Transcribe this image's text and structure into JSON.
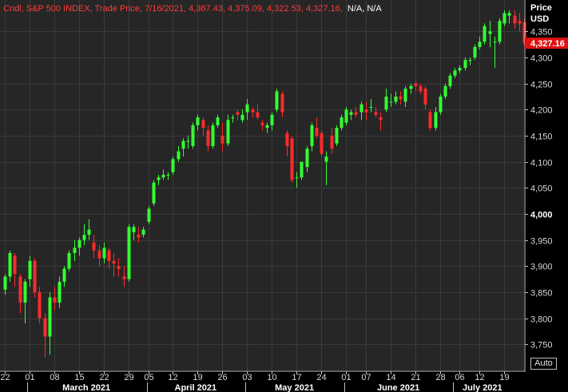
{
  "header": {
    "main": "Cndl, S&P 500 INDEX, Trade Price, 7/16/2021, 4,367.43, 4,375.09, 4,322.53, 4,327.16,",
    "extra": "N/A, N/A"
  },
  "price_axis": {
    "label_line1": "Price",
    "label_line2": "USD",
    "last_price": "4,327.16"
  },
  "auto_button": "Auto",
  "colors": {
    "background": "#000000",
    "plot_bg": "#262626",
    "grid": "#3a3a3a",
    "up": "#33ff33",
    "down": "#ff2a2a",
    "title": "#ff3b3b",
    "badge": "#e01010"
  },
  "chart_data": {
    "type": "candlestick",
    "title": "Cndl, S&P 500 INDEX, Trade Price, 7/16/2021, 4,367.43, 4,375.09, 4,322.53, 4,327.16, N/A, N/A",
    "ylim": [
      3700,
      4410
    ],
    "yticks": [
      3750,
      3800,
      3850,
      3900,
      3950,
      4000,
      4050,
      4100,
      4150,
      4200,
      4250,
      4300,
      4350
    ],
    "ytick_labels": [
      "3,750",
      "3,800",
      "3,850",
      "3,900",
      "3,950",
      "4,000",
      "4,050",
      "4,100",
      "4,150",
      "4,200",
      "4,250",
      "4,300",
      "4,350"
    ],
    "bold_tick": 4000,
    "grid": true,
    "last_price": 4327.16,
    "day_ticks": [
      {
        "label": "22",
        "index": 0
      },
      {
        "label": "01",
        "index": 5
      },
      {
        "label": "08",
        "index": 10
      },
      {
        "label": "15",
        "index": 15
      },
      {
        "label": "22",
        "index": 20
      },
      {
        "label": "29",
        "index": 25
      },
      {
        "label": "05",
        "index": 29
      },
      {
        "label": "12",
        "index": 34
      },
      {
        "label": "19",
        "index": 39
      },
      {
        "label": "26",
        "index": 44
      },
      {
        "label": "03",
        "index": 49
      },
      {
        "label": "10",
        "index": 54
      },
      {
        "label": "17",
        "index": 59
      },
      {
        "label": "24",
        "index": 64
      },
      {
        "label": "01",
        "index": 69
      },
      {
        "label": "07",
        "index": 73
      },
      {
        "label": "14",
        "index": 78
      },
      {
        "label": "21",
        "index": 83
      },
      {
        "label": "28",
        "index": 88
      },
      {
        "label": "06",
        "index": 92
      },
      {
        "label": "12",
        "index": 96
      },
      {
        "label": "19",
        "index": 101
      }
    ],
    "months": [
      {
        "label": "March 2021",
        "start": 5,
        "end": 28
      },
      {
        "label": "April 2021",
        "start": 29,
        "end": 48
      },
      {
        "label": "May 2021",
        "start": 49,
        "end": 68
      },
      {
        "label": "June 2021",
        "start": 69,
        "end": 90
      },
      {
        "label": "July 2021",
        "start": 91,
        "end": 102
      }
    ],
    "ohlc": [
      [
        3855,
        3885,
        3845,
        3880
      ],
      [
        3880,
        3930,
        3870,
        3925
      ],
      [
        3920,
        3925,
        3860,
        3885
      ],
      [
        3880,
        3885,
        3810,
        3830
      ],
      [
        3830,
        3875,
        3790,
        3870
      ],
      [
        3875,
        3920,
        3860,
        3910
      ],
      [
        3910,
        3915,
        3840,
        3850
      ],
      [
        3850,
        3860,
        3790,
        3800
      ],
      [
        3800,
        3810,
        3725,
        3765
      ],
      [
        3765,
        3850,
        3730,
        3840
      ],
      [
        3840,
        3860,
        3815,
        3830
      ],
      [
        3830,
        3880,
        3820,
        3870
      ],
      [
        3870,
        3900,
        3860,
        3895
      ],
      [
        3895,
        3930,
        3890,
        3925
      ],
      [
        3925,
        3950,
        3910,
        3935
      ],
      [
        3935,
        3955,
        3920,
        3950
      ],
      [
        3950,
        3980,
        3940,
        3960
      ],
      [
        3960,
        3990,
        3950,
        3970
      ],
      [
        3945,
        3960,
        3915,
        3930
      ],
      [
        3930,
        3940,
        3900,
        3915
      ],
      [
        3915,
        3945,
        3905,
        3935
      ],
      [
        3930,
        3935,
        3895,
        3910
      ],
      [
        3910,
        3925,
        3880,
        3905
      ],
      [
        3900,
        3915,
        3880,
        3895
      ],
      [
        3880,
        3900,
        3860,
        3875
      ],
      [
        3875,
        3980,
        3870,
        3975
      ],
      [
        3965,
        3980,
        3950,
        3975
      ],
      [
        3960,
        3975,
        3945,
        3955
      ],
      [
        3960,
        3975,
        3955,
        3970
      ],
      [
        3985,
        4015,
        3980,
        4010
      ],
      [
        4020,
        4065,
        4015,
        4060
      ],
      [
        4065,
        4075,
        4055,
        4070
      ],
      [
        4070,
        4085,
        4065,
        4075
      ],
      [
        4075,
        4080,
        4065,
        4075
      ],
      [
        4080,
        4110,
        4075,
        4105
      ],
      [
        4105,
        4130,
        4100,
        4120
      ],
      [
        4125,
        4145,
        4110,
        4140
      ],
      [
        4140,
        4150,
        4125,
        4140
      ],
      [
        4130,
        4175,
        4125,
        4170
      ],
      [
        4170,
        4190,
        4160,
        4185
      ],
      [
        4180,
        4185,
        4150,
        4165
      ],
      [
        4160,
        4170,
        4120,
        4130
      ],
      [
        4130,
        4175,
        4125,
        4170
      ],
      [
        4170,
        4190,
        4165,
        4185
      ],
      [
        4150,
        4175,
        4120,
        4135
      ],
      [
        4135,
        4190,
        4130,
        4180
      ],
      [
        4185,
        4190,
        4175,
        4185
      ],
      [
        4195,
        4200,
        4180,
        4190
      ],
      [
        4180,
        4200,
        4175,
        4190
      ],
      [
        4195,
        4220,
        4180,
        4210
      ],
      [
        4200,
        4205,
        4185,
        4195
      ],
      [
        4195,
        4210,
        4180,
        4185
      ],
      [
        4175,
        4180,
        4160,
        4170
      ],
      [
        4165,
        4175,
        4155,
        4170
      ],
      [
        4170,
        4195,
        4160,
        4190
      ],
      [
        4200,
        4240,
        4195,
        4235
      ],
      [
        4230,
        4235,
        4185,
        4195
      ],
      [
        4155,
        4160,
        4110,
        4130
      ],
      [
        4145,
        4150,
        4060,
        4065
      ],
      [
        4070,
        4080,
        4050,
        4070
      ],
      [
        4070,
        4100,
        4065,
        4100
      ],
      [
        4090,
        4130,
        4080,
        4125
      ],
      [
        4130,
        4175,
        4120,
        4170
      ],
      [
        4165,
        4185,
        4145,
        4150
      ],
      [
        4155,
        4160,
        4110,
        4115
      ],
      [
        4100,
        4120,
        4055,
        4110
      ],
      [
        4150,
        4165,
        4115,
        4125
      ],
      [
        4135,
        4170,
        4130,
        4165
      ],
      [
        4165,
        4190,
        4160,
        4185
      ],
      [
        4175,
        4205,
        4170,
        4200
      ],
      [
        4190,
        4200,
        4180,
        4195
      ],
      [
        4195,
        4205,
        4185,
        4190
      ],
      [
        4195,
        4215,
        4180,
        4210
      ],
      [
        4200,
        4215,
        4180,
        4195
      ],
      [
        4205,
        4220,
        4195,
        4205
      ],
      [
        4195,
        4205,
        4185,
        4190
      ],
      [
        4185,
        4195,
        4160,
        4180
      ],
      [
        4200,
        4240,
        4195,
        4225
      ],
      [
        4215,
        4230,
        4205,
        4215
      ],
      [
        4215,
        4235,
        4210,
        4225
      ],
      [
        4225,
        4235,
        4210,
        4220
      ],
      [
        4215,
        4245,
        4205,
        4240
      ],
      [
        4240,
        4250,
        4230,
        4245
      ],
      [
        4250,
        4255,
        4235,
        4245
      ],
      [
        4245,
        4250,
        4230,
        4235
      ],
      [
        4240,
        4245,
        4200,
        4210
      ],
      [
        4195,
        4200,
        4160,
        4165
      ],
      [
        4165,
        4205,
        4160,
        4195
      ],
      [
        4195,
        4230,
        4190,
        4225
      ],
      [
        4225,
        4250,
        4220,
        4245
      ],
      [
        4245,
        4270,
        4240,
        4265
      ],
      [
        4265,
        4280,
        4260,
        4275
      ],
      [
        4275,
        4285,
        4270,
        4280
      ],
      [
        4280,
        4300,
        4275,
        4295
      ],
      [
        4295,
        4300,
        4285,
        4295
      ],
      [
        4300,
        4325,
        4295,
        4320
      ],
      [
        4320,
        4340,
        4315,
        4330
      ],
      [
        4330,
        4365,
        4325,
        4360
      ],
      [
        4345,
        4370,
        4320,
        4350
      ],
      [
        4330,
        4340,
        4280,
        4330
      ],
      [
        4330,
        4375,
        4325,
        4370
      ],
      [
        4365,
        4390,
        4360,
        4385
      ],
      [
        4380,
        4390,
        4365,
        4385
      ],
      [
        4380,
        4390,
        4355,
        4365
      ],
      [
        4370,
        4385,
        4350,
        4365
      ],
      [
        4367.43,
        4375.09,
        4322.53,
        4327.16
      ]
    ]
  }
}
